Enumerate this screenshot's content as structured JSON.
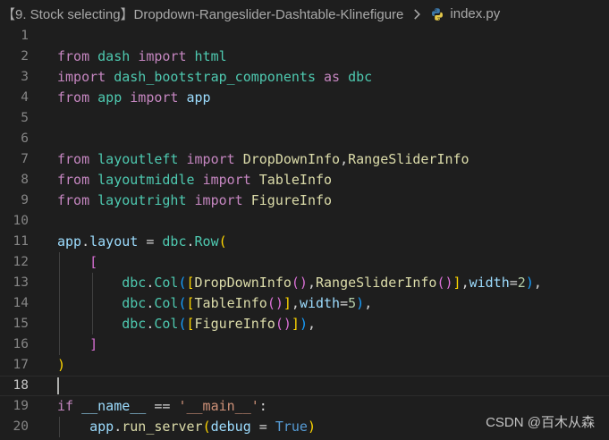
{
  "breadcrumb": {
    "folder": "【9. Stock selecting】Dropdown-Rangeslider-Dashtable-Klinefigure",
    "separator_icon": "chevron-right-icon",
    "file_icon": "python-icon",
    "file": "index.py"
  },
  "editor": {
    "active_line": 18,
    "lines": [
      {
        "n": "1",
        "tokens": []
      },
      {
        "n": "2",
        "tokens": [
          {
            "t": "from",
            "c": "#c586c0"
          },
          {
            "t": " "
          },
          {
            "t": "dash",
            "c": "#4ec9b0"
          },
          {
            "t": " "
          },
          {
            "t": "import",
            "c": "#c586c0"
          },
          {
            "t": " "
          },
          {
            "t": "html",
            "c": "#4ec9b0"
          }
        ]
      },
      {
        "n": "3",
        "tokens": [
          {
            "t": "import",
            "c": "#c586c0"
          },
          {
            "t": " "
          },
          {
            "t": "dash_bootstrap_components",
            "c": "#4ec9b0"
          },
          {
            "t": " "
          },
          {
            "t": "as",
            "c": "#c586c0"
          },
          {
            "t": " "
          },
          {
            "t": "dbc",
            "c": "#4ec9b0"
          }
        ]
      },
      {
        "n": "4",
        "tokens": [
          {
            "t": "from",
            "c": "#c586c0"
          },
          {
            "t": " "
          },
          {
            "t": "app",
            "c": "#4ec9b0"
          },
          {
            "t": " "
          },
          {
            "t": "import",
            "c": "#c586c0"
          },
          {
            "t": " "
          },
          {
            "t": "app",
            "c": "#9cdcfe"
          }
        ]
      },
      {
        "n": "5",
        "tokens": []
      },
      {
        "n": "6",
        "tokens": []
      },
      {
        "n": "7",
        "tokens": [
          {
            "t": "from",
            "c": "#c586c0"
          },
          {
            "t": " "
          },
          {
            "t": "layoutleft",
            "c": "#4ec9b0"
          },
          {
            "t": " "
          },
          {
            "t": "import",
            "c": "#c586c0"
          },
          {
            "t": " "
          },
          {
            "t": "DropDownInfo",
            "c": "#dcdcaa"
          },
          {
            "t": ","
          },
          {
            "t": "RangeSliderInfo",
            "c": "#dcdcaa"
          }
        ]
      },
      {
        "n": "8",
        "tokens": [
          {
            "t": "from",
            "c": "#c586c0"
          },
          {
            "t": " "
          },
          {
            "t": "layoutmiddle",
            "c": "#4ec9b0"
          },
          {
            "t": " "
          },
          {
            "t": "import",
            "c": "#c586c0"
          },
          {
            "t": " "
          },
          {
            "t": "TableInfo",
            "c": "#dcdcaa"
          }
        ]
      },
      {
        "n": "9",
        "tokens": [
          {
            "t": "from",
            "c": "#c586c0"
          },
          {
            "t": " "
          },
          {
            "t": "layoutright",
            "c": "#4ec9b0"
          },
          {
            "t": " "
          },
          {
            "t": "import",
            "c": "#c586c0"
          },
          {
            "t": " "
          },
          {
            "t": "FigureInfo",
            "c": "#dcdcaa"
          }
        ]
      },
      {
        "n": "10",
        "tokens": []
      },
      {
        "n": "11",
        "tokens": [
          {
            "t": "app",
            "c": "#9cdcfe"
          },
          {
            "t": "."
          },
          {
            "t": "layout",
            "c": "#9cdcfe"
          },
          {
            "t": " = "
          },
          {
            "t": "dbc",
            "c": "#4ec9b0"
          },
          {
            "t": "."
          },
          {
            "t": "Row",
            "c": "#4ec9b0"
          },
          {
            "t": "(",
            "c": "#ffd700"
          }
        ]
      },
      {
        "n": "12",
        "tokens": [
          {
            "t": "    "
          },
          {
            "t": "[",
            "c": "#da70d6"
          }
        ]
      },
      {
        "n": "13",
        "tokens": [
          {
            "t": "        "
          },
          {
            "t": "dbc",
            "c": "#4ec9b0"
          },
          {
            "t": "."
          },
          {
            "t": "Col",
            "c": "#4ec9b0"
          },
          {
            "t": "(",
            "c": "#179fff"
          },
          {
            "t": "[",
            "c": "#ffd700"
          },
          {
            "t": "DropDownInfo",
            "c": "#dcdcaa"
          },
          {
            "t": "()",
            "c": "#da70d6"
          },
          {
            "t": ","
          },
          {
            "t": "RangeSliderInfo",
            "c": "#dcdcaa"
          },
          {
            "t": "()",
            "c": "#da70d6"
          },
          {
            "t": "]",
            "c": "#ffd700"
          },
          {
            "t": ","
          },
          {
            "t": "width",
            "c": "#9cdcfe"
          },
          {
            "t": "="
          },
          {
            "t": "2",
            "c": "#b5cea8"
          },
          {
            "t": ")",
            "c": "#179fff"
          },
          {
            "t": ","
          }
        ]
      },
      {
        "n": "14",
        "tokens": [
          {
            "t": "        "
          },
          {
            "t": "dbc",
            "c": "#4ec9b0"
          },
          {
            "t": "."
          },
          {
            "t": "Col",
            "c": "#4ec9b0"
          },
          {
            "t": "(",
            "c": "#179fff"
          },
          {
            "t": "[",
            "c": "#ffd700"
          },
          {
            "t": "TableInfo",
            "c": "#dcdcaa"
          },
          {
            "t": "()",
            "c": "#da70d6"
          },
          {
            "t": "]",
            "c": "#ffd700"
          },
          {
            "t": ","
          },
          {
            "t": "width",
            "c": "#9cdcfe"
          },
          {
            "t": "="
          },
          {
            "t": "5",
            "c": "#b5cea8"
          },
          {
            "t": ")",
            "c": "#179fff"
          },
          {
            "t": ","
          }
        ]
      },
      {
        "n": "15",
        "tokens": [
          {
            "t": "        "
          },
          {
            "t": "dbc",
            "c": "#4ec9b0"
          },
          {
            "t": "."
          },
          {
            "t": "Col",
            "c": "#4ec9b0"
          },
          {
            "t": "(",
            "c": "#179fff"
          },
          {
            "t": "[",
            "c": "#ffd700"
          },
          {
            "t": "FigureInfo",
            "c": "#dcdcaa"
          },
          {
            "t": "()",
            "c": "#da70d6"
          },
          {
            "t": "]",
            "c": "#ffd700"
          },
          {
            "t": ")",
            "c": "#179fff"
          },
          {
            "t": ","
          }
        ]
      },
      {
        "n": "16",
        "tokens": [
          {
            "t": "    "
          },
          {
            "t": "]",
            "c": "#da70d6"
          }
        ]
      },
      {
        "n": "17",
        "tokens": [
          {
            "t": ")",
            "c": "#ffd700"
          }
        ]
      },
      {
        "n": "18",
        "tokens": []
      },
      {
        "n": "19",
        "tokens": [
          {
            "t": "if",
            "c": "#c586c0"
          },
          {
            "t": " "
          },
          {
            "t": "__name__",
            "c": "#9cdcfe"
          },
          {
            "t": " == "
          },
          {
            "t": "'__main__'",
            "c": "#ce9178"
          },
          {
            "t": ":"
          }
        ]
      },
      {
        "n": "20",
        "tokens": [
          {
            "t": "    "
          },
          {
            "t": "app",
            "c": "#9cdcfe"
          },
          {
            "t": "."
          },
          {
            "t": "run_server",
            "c": "#dcdcaa"
          },
          {
            "t": "(",
            "c": "#ffd700"
          },
          {
            "t": "debug",
            "c": "#9cdcfe"
          },
          {
            "t": " = "
          },
          {
            "t": "True",
            "c": "#569cd6"
          },
          {
            "t": ")",
            "c": "#ffd700"
          }
        ]
      }
    ]
  },
  "watermark": "CSDN @百木从森"
}
